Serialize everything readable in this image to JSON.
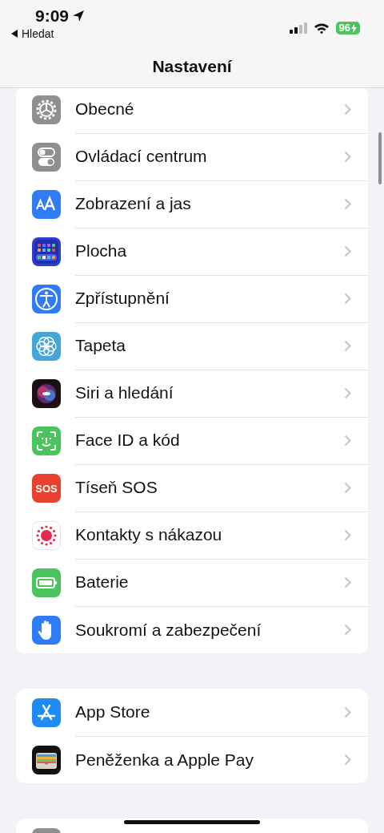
{
  "status_bar": {
    "time": "9:09",
    "location_active": true,
    "back_label": "Hledat",
    "battery": "96",
    "charging": true
  },
  "navigation": {
    "title": "Nastavení"
  },
  "sections": [
    {
      "items": [
        {
          "kind": "gear",
          "label": "Obecné"
        },
        {
          "kind": "toggles",
          "label": "Ovládací centrum"
        },
        {
          "kind": "text-size",
          "label": "Zobrazení a jas"
        },
        {
          "kind": "app-grid",
          "label": "Plocha"
        },
        {
          "kind": "accessibility",
          "label": "Zpřístupnění"
        },
        {
          "kind": "flower",
          "label": "Tapeta"
        },
        {
          "kind": "orb",
          "label": "Siri a hledání"
        },
        {
          "kind": "face",
          "label": "Face ID a kód"
        },
        {
          "kind": "sos",
          "icon_text": "SOS",
          "label": "Tíseň SOS"
        },
        {
          "kind": "dots-sun",
          "label": "Kontakty s nákazou"
        },
        {
          "kind": "battery",
          "label": "Baterie"
        },
        {
          "kind": "hand",
          "label": "Soukromí a zabezpečení"
        }
      ]
    },
    {
      "items": [
        {
          "kind": "app-store",
          "label": "App Store"
        },
        {
          "kind": "wallet",
          "label": "Peněženka a Apple Pay"
        }
      ]
    },
    {
      "items": [
        {
          "kind": "grey"
        }
      ]
    }
  ]
}
